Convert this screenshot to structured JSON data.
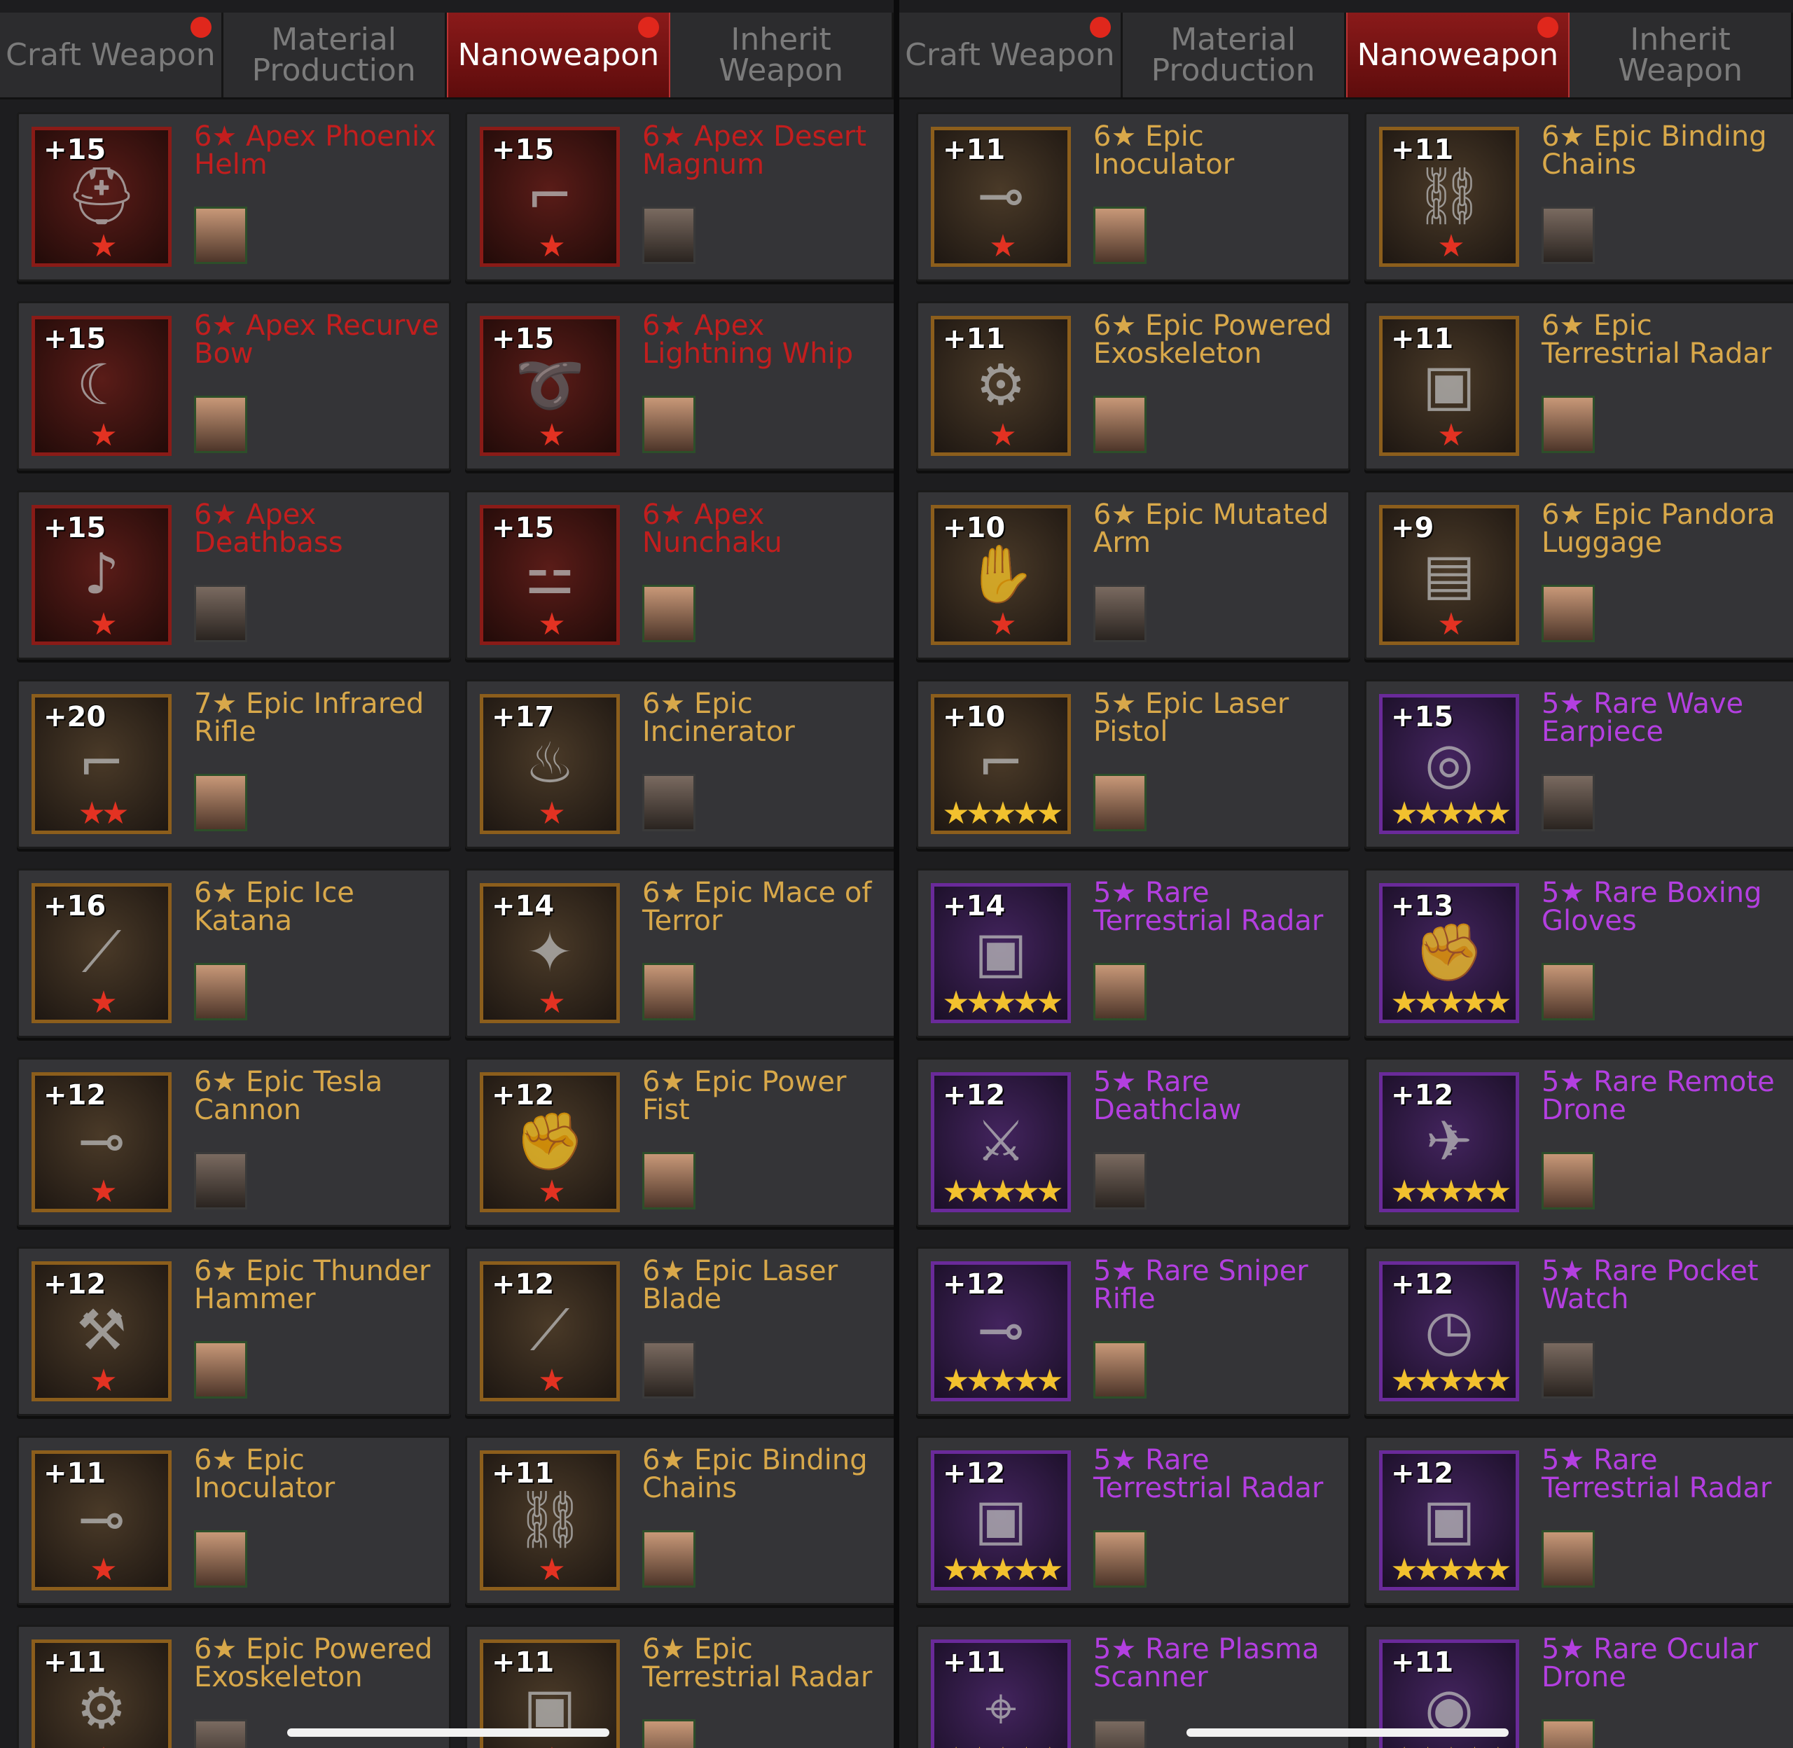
{
  "tabs": [
    "Craft Weapon",
    "Material Production",
    "Nanoweapon",
    "Inherit Weapon"
  ],
  "active_tab": "Nanoweapon",
  "colors": {
    "apex": "#c21e1e",
    "epic": "#d8a84a",
    "rare": "#b33fe0",
    "active_tab": "#7a1414"
  },
  "left_panel": {
    "items": [
      {
        "level": "+15",
        "name": "6★ Apex Phoenix Helm",
        "tier": "apex",
        "stars": "★",
        "icon": "helmet-icon"
      },
      {
        "level": "+15",
        "name": "6★ Apex Desert Magnum",
        "tier": "apex",
        "stars": "★",
        "icon": "revolver-icon"
      },
      {
        "level": "+15",
        "name": "6★ Apex Recurve Bow",
        "tier": "apex",
        "stars": "★",
        "icon": "bow-icon"
      },
      {
        "level": "+15",
        "name": "6★ Apex Lightning Whip",
        "tier": "apex",
        "stars": "★",
        "icon": "whip-icon"
      },
      {
        "level": "+15",
        "name": "6★ Apex Deathbass",
        "tier": "apex",
        "stars": "★",
        "icon": "guitar-icon"
      },
      {
        "level": "+15",
        "name": "6★ Apex Nunchaku",
        "tier": "apex",
        "stars": "★",
        "icon": "nunchaku-icon"
      },
      {
        "level": "+20",
        "name": "7★ Epic Infrared Rifle",
        "tier": "epic",
        "stars": "★★",
        "icon": "rifle-icon"
      },
      {
        "level": "+17",
        "name": "6★ Epic Incinerator",
        "tier": "epic",
        "stars": "★",
        "icon": "flamethrower-icon"
      },
      {
        "level": "+16",
        "name": "6★ Epic Ice Katana",
        "tier": "epic",
        "stars": "★",
        "icon": "katana-icon"
      },
      {
        "level": "+14",
        "name": "6★ Epic Mace of Terror",
        "tier": "epic",
        "stars": "★",
        "icon": "mace-icon"
      },
      {
        "level": "+12",
        "name": "6★ Epic Tesla Cannon",
        "tier": "epic",
        "stars": "★",
        "icon": "cannon-icon"
      },
      {
        "level": "+12",
        "name": "6★ Epic Power Fist",
        "tier": "epic",
        "stars": "★",
        "icon": "fist-icon"
      },
      {
        "level": "+12",
        "name": "6★ Epic Thunder Hammer",
        "tier": "epic",
        "stars": "★",
        "icon": "hammer-icon"
      },
      {
        "level": "+12",
        "name": "6★ Epic Laser Blade",
        "tier": "epic",
        "stars": "★",
        "icon": "blade-icon"
      },
      {
        "level": "+11",
        "name": "6★ Epic Inoculator",
        "tier": "epic",
        "stars": "★",
        "icon": "syringe-gun-icon"
      },
      {
        "level": "+11",
        "name": "6★ Epic Binding Chains",
        "tier": "epic",
        "stars": "★",
        "icon": "chains-icon"
      },
      {
        "level": "+11",
        "name": "6★ Epic Powered Exoskeleton",
        "tier": "epic",
        "stars": "★",
        "icon": "exoskeleton-icon"
      },
      {
        "level": "+11",
        "name": "6★ Epic Terrestrial Radar",
        "tier": "epic",
        "stars": "★",
        "icon": "radar-icon"
      }
    ]
  },
  "right_panel": {
    "items": [
      {
        "level": "+11",
        "name": "6★ Epic Inoculator",
        "tier": "epic",
        "stars": "★",
        "icon": "syringe-gun-icon"
      },
      {
        "level": "+11",
        "name": "6★ Epic Binding Chains",
        "tier": "epic",
        "stars": "★",
        "icon": "chains-icon"
      },
      {
        "level": "+11",
        "name": "6★ Epic Powered Exoskeleton",
        "tier": "epic",
        "stars": "★",
        "icon": "exoskeleton-icon"
      },
      {
        "level": "+11",
        "name": "6★ Epic Terrestrial Radar",
        "tier": "epic",
        "stars": "★",
        "icon": "radar-icon"
      },
      {
        "level": "+10",
        "name": "6★ Epic Mutated Arm",
        "tier": "epic",
        "stars": "★",
        "icon": "claw-arm-icon"
      },
      {
        "level": "+9",
        "name": "6★ Epic Pandora Luggage",
        "tier": "epic",
        "stars": "★",
        "icon": "luggage-icon"
      },
      {
        "level": "+10",
        "name": "5★ Epic Laser Pistol",
        "tier": "epic",
        "stars": "★★★★★",
        "icon": "pistol-icon"
      },
      {
        "level": "+15",
        "name": "5★ Rare Wave Earpiece",
        "tier": "rare",
        "stars": "★★★★★",
        "icon": "headphones-icon"
      },
      {
        "level": "+14",
        "name": "5★ Rare Terrestrial Radar",
        "tier": "rare",
        "stars": "★★★★★",
        "icon": "radar-icon"
      },
      {
        "level": "+13",
        "name": "5★ Rare Boxing Gloves",
        "tier": "rare",
        "stars": "★★★★★",
        "icon": "glove-icon"
      },
      {
        "level": "+12",
        "name": "5★ Rare Deathclaw",
        "tier": "rare",
        "stars": "★★★★★",
        "icon": "claw-icon"
      },
      {
        "level": "+12",
        "name": "5★ Rare Remote Drone",
        "tier": "rare",
        "stars": "★★★★★",
        "icon": "drone-icon"
      },
      {
        "level": "+12",
        "name": "5★ Rare Sniper Rifle",
        "tier": "rare",
        "stars": "★★★★★",
        "icon": "sniper-icon"
      },
      {
        "level": "+12",
        "name": "5★ Rare Pocket Watch",
        "tier": "rare",
        "stars": "★★★★★",
        "icon": "watch-icon"
      },
      {
        "level": "+12",
        "name": "5★ Rare Terrestrial Radar",
        "tier": "rare",
        "stars": "★★★★★",
        "icon": "radar-icon"
      },
      {
        "level": "+12",
        "name": "5★ Rare Terrestrial Radar",
        "tier": "rare",
        "stars": "★★★★★",
        "icon": "radar-icon"
      },
      {
        "level": "+11",
        "name": "5★ Rare Plasma Scanner",
        "tier": "rare",
        "stars": "★★★★★",
        "icon": "scanner-icon"
      },
      {
        "level": "+11",
        "name": "5★ Rare Ocular Drone",
        "tier": "rare",
        "stars": "★★★★★",
        "icon": "eye-drone-icon"
      }
    ]
  }
}
